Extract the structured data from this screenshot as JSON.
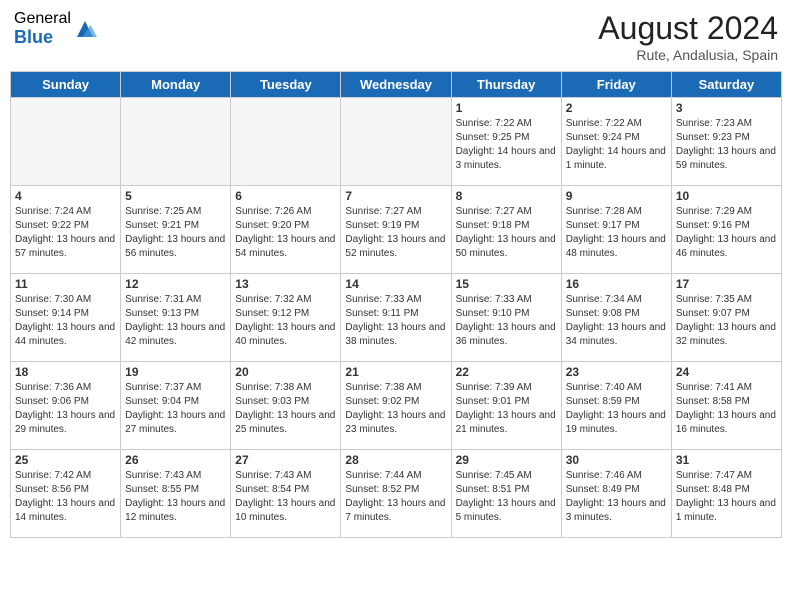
{
  "header": {
    "logo_general": "General",
    "logo_blue": "Blue",
    "month_year": "August 2024",
    "location": "Rute, Andalusia, Spain"
  },
  "days_of_week": [
    "Sunday",
    "Monday",
    "Tuesday",
    "Wednesday",
    "Thursday",
    "Friday",
    "Saturday"
  ],
  "weeks": [
    [
      {
        "day": "",
        "empty": true
      },
      {
        "day": "",
        "empty": true
      },
      {
        "day": "",
        "empty": true
      },
      {
        "day": "",
        "empty": true
      },
      {
        "day": "1",
        "sunrise": "7:22 AM",
        "sunset": "9:25 PM",
        "daylight": "14 hours and 3 minutes."
      },
      {
        "day": "2",
        "sunrise": "7:22 AM",
        "sunset": "9:24 PM",
        "daylight": "14 hours and 1 minute."
      },
      {
        "day": "3",
        "sunrise": "7:23 AM",
        "sunset": "9:23 PM",
        "daylight": "13 hours and 59 minutes."
      }
    ],
    [
      {
        "day": "4",
        "sunrise": "7:24 AM",
        "sunset": "9:22 PM",
        "daylight": "13 hours and 57 minutes."
      },
      {
        "day": "5",
        "sunrise": "7:25 AM",
        "sunset": "9:21 PM",
        "daylight": "13 hours and 56 minutes."
      },
      {
        "day": "6",
        "sunrise": "7:26 AM",
        "sunset": "9:20 PM",
        "daylight": "13 hours and 54 minutes."
      },
      {
        "day": "7",
        "sunrise": "7:27 AM",
        "sunset": "9:19 PM",
        "daylight": "13 hours and 52 minutes."
      },
      {
        "day": "8",
        "sunrise": "7:27 AM",
        "sunset": "9:18 PM",
        "daylight": "13 hours and 50 minutes."
      },
      {
        "day": "9",
        "sunrise": "7:28 AM",
        "sunset": "9:17 PM",
        "daylight": "13 hours and 48 minutes."
      },
      {
        "day": "10",
        "sunrise": "7:29 AM",
        "sunset": "9:16 PM",
        "daylight": "13 hours and 46 minutes."
      }
    ],
    [
      {
        "day": "11",
        "sunrise": "7:30 AM",
        "sunset": "9:14 PM",
        "daylight": "13 hours and 44 minutes."
      },
      {
        "day": "12",
        "sunrise": "7:31 AM",
        "sunset": "9:13 PM",
        "daylight": "13 hours and 42 minutes."
      },
      {
        "day": "13",
        "sunrise": "7:32 AM",
        "sunset": "9:12 PM",
        "daylight": "13 hours and 40 minutes."
      },
      {
        "day": "14",
        "sunrise": "7:33 AM",
        "sunset": "9:11 PM",
        "daylight": "13 hours and 38 minutes."
      },
      {
        "day": "15",
        "sunrise": "7:33 AM",
        "sunset": "9:10 PM",
        "daylight": "13 hours and 36 minutes."
      },
      {
        "day": "16",
        "sunrise": "7:34 AM",
        "sunset": "9:08 PM",
        "daylight": "13 hours and 34 minutes."
      },
      {
        "day": "17",
        "sunrise": "7:35 AM",
        "sunset": "9:07 PM",
        "daylight": "13 hours and 32 minutes."
      }
    ],
    [
      {
        "day": "18",
        "sunrise": "7:36 AM",
        "sunset": "9:06 PM",
        "daylight": "13 hours and 29 minutes."
      },
      {
        "day": "19",
        "sunrise": "7:37 AM",
        "sunset": "9:04 PM",
        "daylight": "13 hours and 27 minutes."
      },
      {
        "day": "20",
        "sunrise": "7:38 AM",
        "sunset": "9:03 PM",
        "daylight": "13 hours and 25 minutes."
      },
      {
        "day": "21",
        "sunrise": "7:38 AM",
        "sunset": "9:02 PM",
        "daylight": "13 hours and 23 minutes."
      },
      {
        "day": "22",
        "sunrise": "7:39 AM",
        "sunset": "9:01 PM",
        "daylight": "13 hours and 21 minutes."
      },
      {
        "day": "23",
        "sunrise": "7:40 AM",
        "sunset": "8:59 PM",
        "daylight": "13 hours and 19 minutes."
      },
      {
        "day": "24",
        "sunrise": "7:41 AM",
        "sunset": "8:58 PM",
        "daylight": "13 hours and 16 minutes."
      }
    ],
    [
      {
        "day": "25",
        "sunrise": "7:42 AM",
        "sunset": "8:56 PM",
        "daylight": "13 hours and 14 minutes."
      },
      {
        "day": "26",
        "sunrise": "7:43 AM",
        "sunset": "8:55 PM",
        "daylight": "13 hours and 12 minutes."
      },
      {
        "day": "27",
        "sunrise": "7:43 AM",
        "sunset": "8:54 PM",
        "daylight": "13 hours and 10 minutes."
      },
      {
        "day": "28",
        "sunrise": "7:44 AM",
        "sunset": "8:52 PM",
        "daylight": "13 hours and 7 minutes."
      },
      {
        "day": "29",
        "sunrise": "7:45 AM",
        "sunset": "8:51 PM",
        "daylight": "13 hours and 5 minutes."
      },
      {
        "day": "30",
        "sunrise": "7:46 AM",
        "sunset": "8:49 PM",
        "daylight": "13 hours and 3 minutes."
      },
      {
        "day": "31",
        "sunrise": "7:47 AM",
        "sunset": "8:48 PM",
        "daylight": "13 hours and 1 minute."
      }
    ]
  ]
}
